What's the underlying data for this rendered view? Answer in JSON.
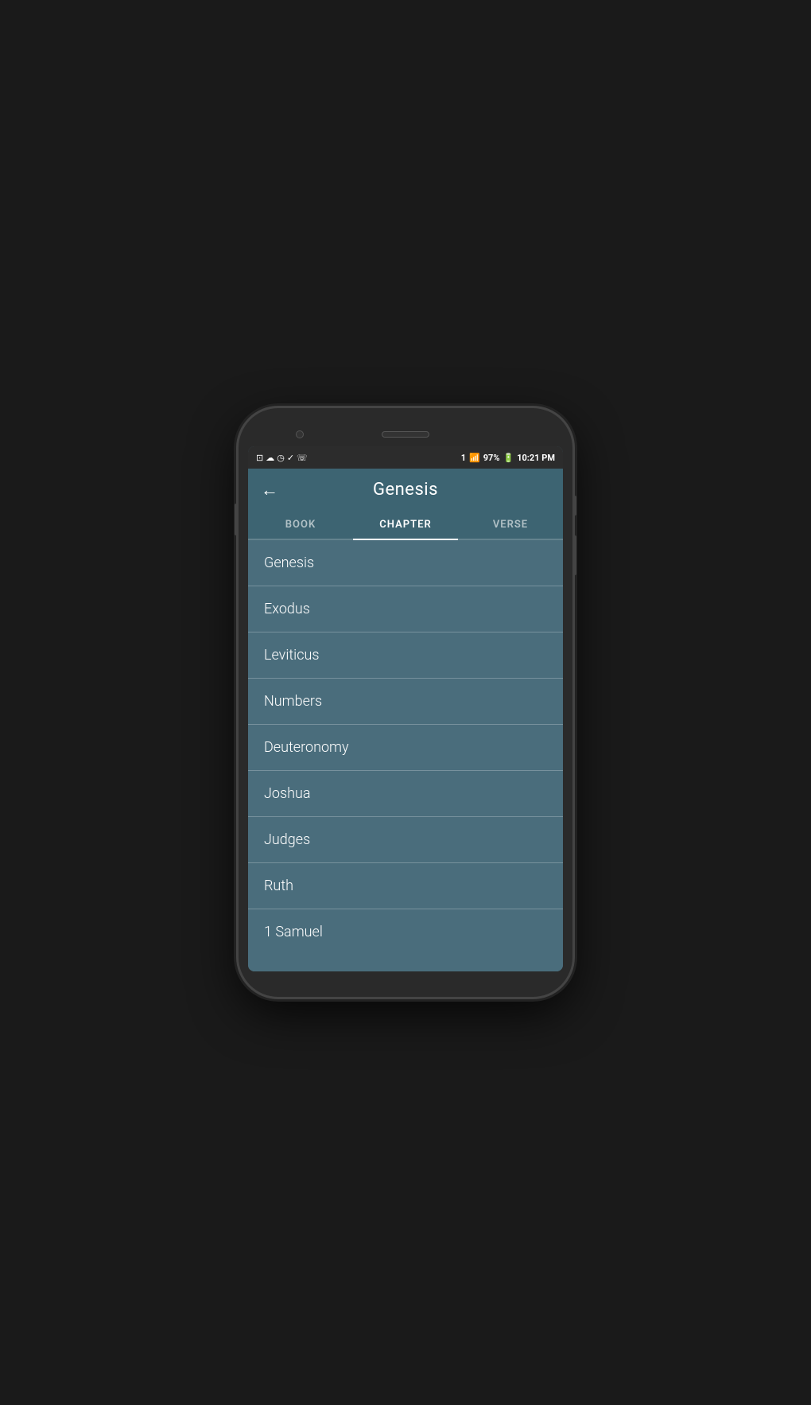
{
  "statusBar": {
    "time": "10:21 PM",
    "battery": "97%",
    "icons": [
      "image",
      "cloud-off",
      "time",
      "check",
      "phone"
    ]
  },
  "header": {
    "title": "Genesis",
    "backLabel": "←"
  },
  "tabs": [
    {
      "id": "book",
      "label": "BOOK",
      "active": false
    },
    {
      "id": "chapter",
      "label": "CHAPTER",
      "active": true
    },
    {
      "id": "verse",
      "label": "VERSE",
      "active": false
    }
  ],
  "books": [
    {
      "id": "genesis",
      "name": "Genesis"
    },
    {
      "id": "exodus",
      "name": "Exodus"
    },
    {
      "id": "leviticus",
      "name": "Leviticus"
    },
    {
      "id": "numbers",
      "name": "Numbers"
    },
    {
      "id": "deuteronomy",
      "name": "Deuteronomy"
    },
    {
      "id": "joshua",
      "name": "Joshua"
    },
    {
      "id": "judges",
      "name": "Judges"
    },
    {
      "id": "ruth",
      "name": "Ruth"
    },
    {
      "id": "1samuel",
      "name": "1 Samuel"
    }
  ]
}
